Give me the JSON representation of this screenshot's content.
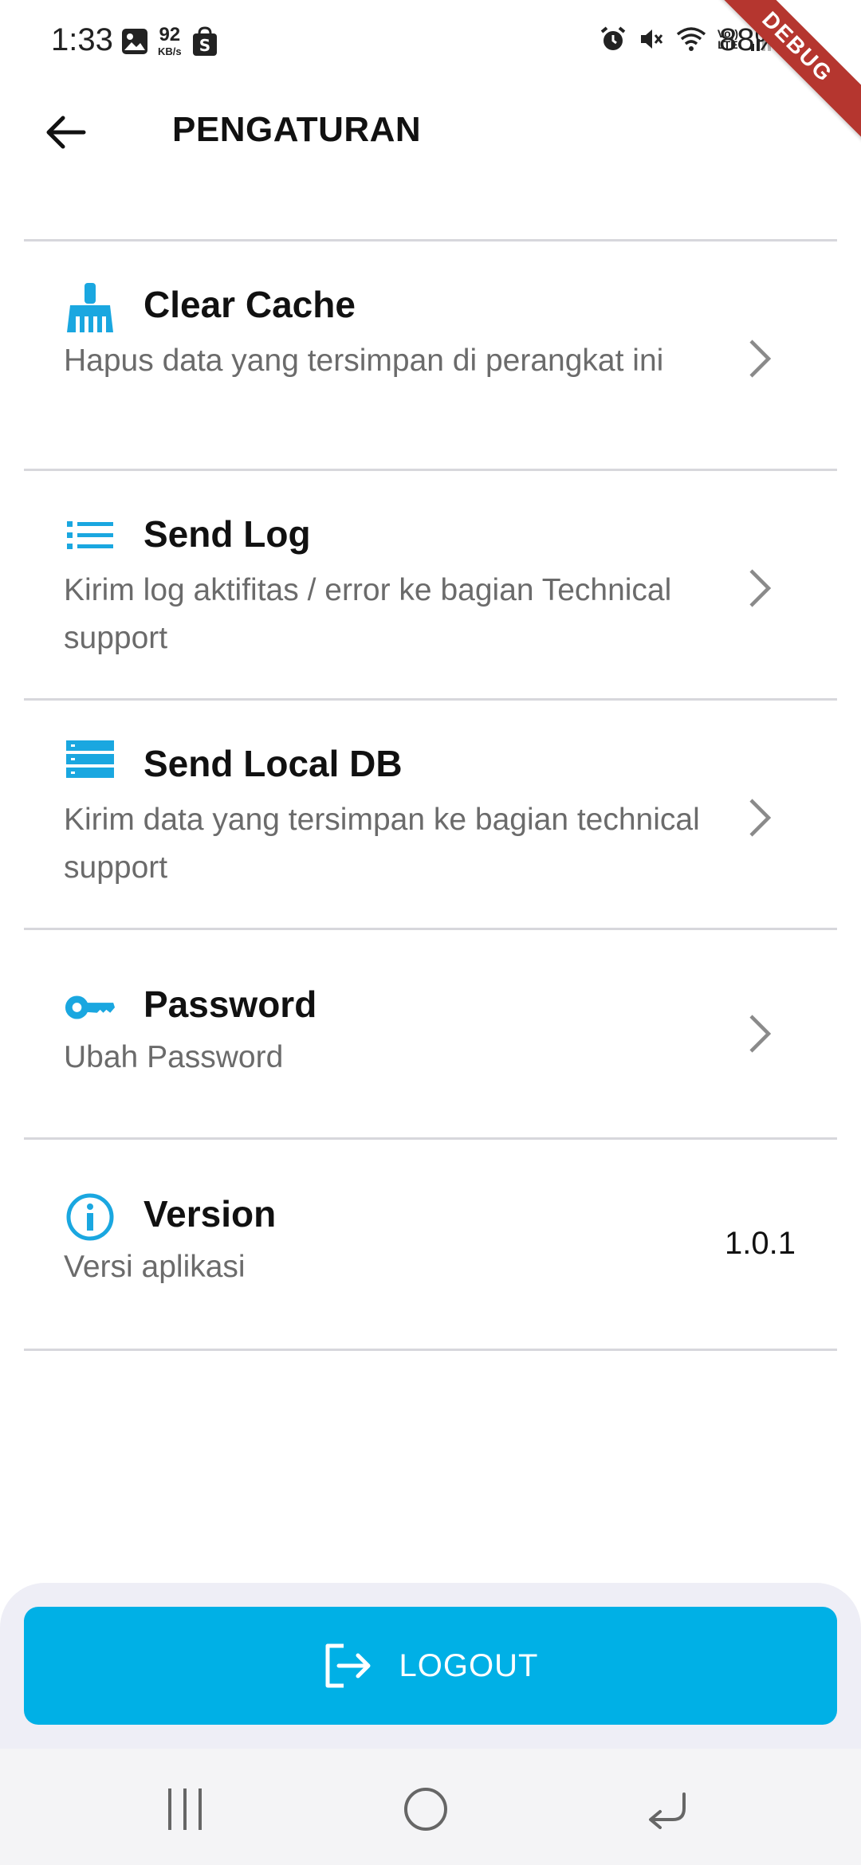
{
  "status_bar": {
    "time": "1:33",
    "speed_value": "92",
    "speed_unit": "KB/s",
    "lte_top": "Vo))",
    "lte_bottom": "LTE",
    "battery": "88%",
    "debug_label": "DEBUG"
  },
  "app_bar": {
    "title": "PENGATURAN"
  },
  "settings": [
    {
      "icon": "broom-icon",
      "title": "Clear Cache",
      "description": "Hapus data yang tersimpan di perangkat ini"
    },
    {
      "icon": "list-icon",
      "title": "Send Log",
      "description": "Kirim log aktifitas / error ke bagian Technical support"
    },
    {
      "icon": "database-icon",
      "title": "Send Local DB",
      "description": "Kirim data yang tersimpan ke bagian technical support"
    },
    {
      "icon": "key-icon",
      "title": "Password",
      "description": "Ubah Password"
    },
    {
      "icon": "info-icon",
      "title": "Version",
      "description": "Versi aplikasi",
      "value": "1.0.1"
    }
  ],
  "logout": {
    "label": "LOGOUT",
    "icon": "logout-icon"
  },
  "colors": {
    "accent": "#00b0e6",
    "icon": "#1aa7e0",
    "divider": "#d7d7dc",
    "debug": "#b5362f"
  }
}
